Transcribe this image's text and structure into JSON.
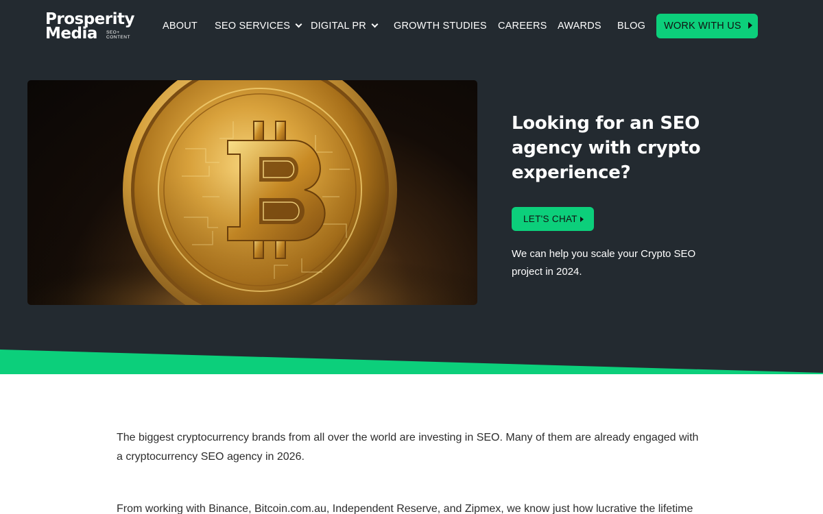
{
  "logo": {
    "line1": "Prosperity",
    "line2": "Media",
    "tagline": "SEO+ CONTENT"
  },
  "nav": {
    "about": "ABOUT",
    "seo_services": "SEO SERVICES",
    "digital_pr": "DIGITAL PR",
    "growth_studies": "GROWTH STUDIES",
    "careers": "CAREERS",
    "awards": "AWARDS",
    "blog": "BLOG",
    "cta": "WORK WITH US"
  },
  "hero": {
    "image_icon": "bitcoin-coin-photo",
    "title": "Looking for an SEO agency with crypto experience?",
    "button": "LET'S CHAT",
    "description": "We can help you scale your Crypto SEO project in 2024."
  },
  "content": {
    "p1": "The biggest cryptocurrency brands from all over the world are investing in SEO. Many of them are already engaged with a cryptocurrency SEO agency in 2026.",
    "p2": "From working with Binance, Bitcoin.com.au, Independent Reserve, and Zipmex, we know just how lucrative the lifetime"
  },
  "colors": {
    "header_bg": "#232a30",
    "accent": "#0ccf7b",
    "text": "#2d2d2d"
  }
}
